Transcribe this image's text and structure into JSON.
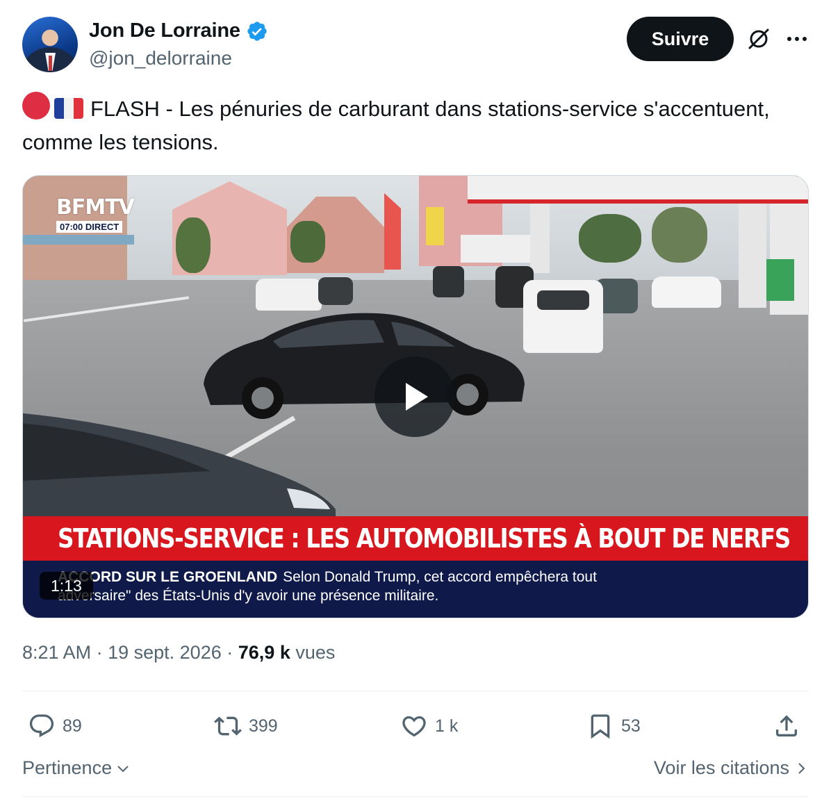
{
  "author": {
    "display_name": "Jon De Lorraine",
    "handle": "@jon_delorraine",
    "verified": true,
    "verified_color": "#1d9bf0"
  },
  "follow_label": "Suivre",
  "icons": {
    "grok": "grok-slash-icon",
    "more": "more-dots-icon",
    "red_circle": "red-circle-emoji",
    "flag": "flag-france-emoji"
  },
  "tweet": {
    "text": "FLASH - Les pénuries de carburant dans stations-service s'accentuent, comme les tensions."
  },
  "video": {
    "channel_logo": "BFMTV",
    "channel_sub": "07:00 DIRECT",
    "banner_headline": "STATIONS-SERVICE : LES AUTOMOBILISTES À BOUT DE NERFS",
    "ticker_label": "ACCORD SUR LE GROENLAND",
    "ticker_text_1": "Selon Donald Trump, cet accord empêchera tout",
    "ticker_text_2": "adversaire\" des États-Unis d'y avoir une présence militaire.",
    "duration": "1:13",
    "banner_color": "#d7161e",
    "ticker_color": "#0f1a4a"
  },
  "meta": {
    "time": "8:21 AM",
    "separator": "·",
    "date": "19 sept. 2026",
    "views_count": "76,9 k",
    "views_label": "vues"
  },
  "actions": {
    "replies": "89",
    "reposts": "399",
    "likes": "1 k",
    "bookmarks": "53"
  },
  "footer": {
    "sort_label": "Pertinence",
    "quotes_label": "Voir les citations"
  }
}
